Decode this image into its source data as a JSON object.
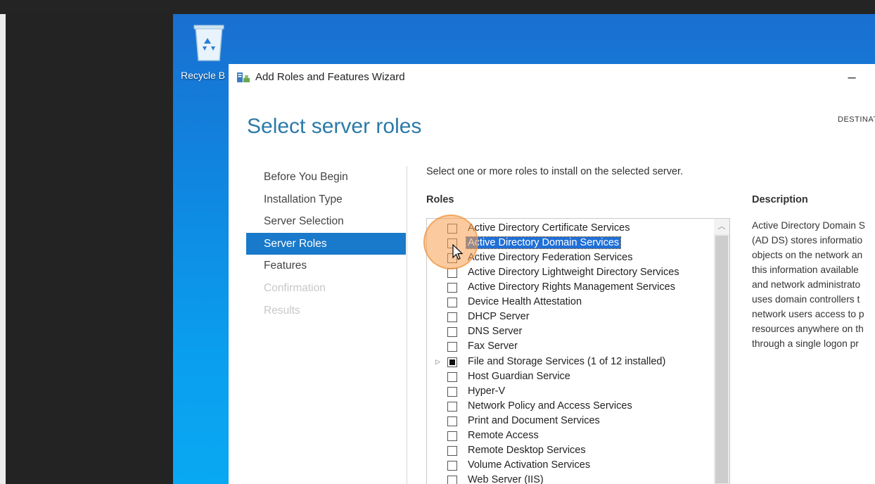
{
  "desktop": {
    "recycle_bin_label": "Recycle B"
  },
  "window": {
    "title": "Add Roles and Features Wizard",
    "minimize_glyph": "–"
  },
  "page": {
    "heading": "Select server roles",
    "destination_label": "DESTINAT",
    "instruction": "Select one or more roles to install on the selected server."
  },
  "nav": {
    "items": [
      {
        "label": "Before You Begin",
        "state": "normal"
      },
      {
        "label": "Installation Type",
        "state": "normal"
      },
      {
        "label": "Server Selection",
        "state": "normal"
      },
      {
        "label": "Server Roles",
        "state": "active"
      },
      {
        "label": "Features",
        "state": "normal"
      },
      {
        "label": "Confirmation",
        "state": "disabled"
      },
      {
        "label": "Results",
        "state": "disabled"
      }
    ]
  },
  "roles": {
    "header": "Roles",
    "items": [
      {
        "label": "Active Directory Certificate Services",
        "checked": false
      },
      {
        "label": "Active Directory Domain Services",
        "checked": false,
        "selected": true
      },
      {
        "label": "Active Directory Federation Services",
        "checked": false
      },
      {
        "label": "Active Directory Lightweight Directory Services",
        "checked": false
      },
      {
        "label": "Active Directory Rights Management Services",
        "checked": false
      },
      {
        "label": "Device Health Attestation",
        "checked": false
      },
      {
        "label": "DHCP Server",
        "checked": false
      },
      {
        "label": "DNS Server",
        "checked": false
      },
      {
        "label": "Fax Server",
        "checked": false
      },
      {
        "label": "File and Storage Services (1 of 12 installed)",
        "checked": "partial",
        "expandable": true
      },
      {
        "label": "Host Guardian Service",
        "checked": false
      },
      {
        "label": "Hyper-V",
        "checked": false
      },
      {
        "label": "Network Policy and Access Services",
        "checked": false
      },
      {
        "label": "Print and Document Services",
        "checked": false
      },
      {
        "label": "Remote Access",
        "checked": false
      },
      {
        "label": "Remote Desktop Services",
        "checked": false
      },
      {
        "label": "Volume Activation Services",
        "checked": false
      },
      {
        "label": "Web Server (IIS)",
        "checked": false
      }
    ]
  },
  "description": {
    "header": "Description",
    "lines": [
      "Active Directory Domain S",
      "(AD DS) stores informatio",
      "objects on the network an",
      "this information available",
      "and network administrato",
      "uses domain controllers t",
      "network users access to p",
      "resources anywhere on th",
      "through a single logon pr"
    ]
  },
  "colors": {
    "accent": "#1979ca",
    "heading": "#2c7aa8",
    "selection": "#1f6fd6",
    "click_highlight": "#f7a050"
  }
}
